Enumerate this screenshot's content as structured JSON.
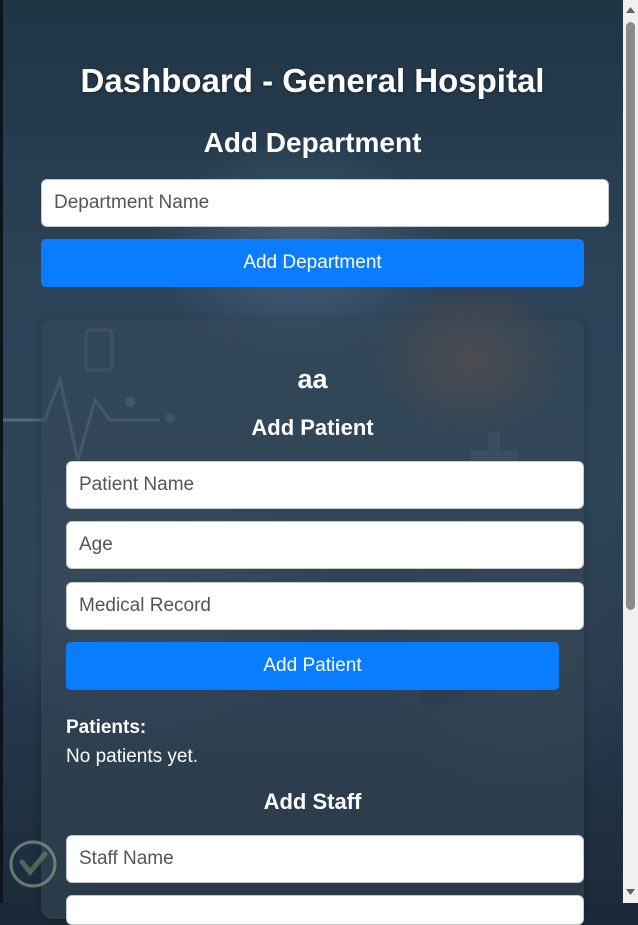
{
  "page_title": "Dashboard - General Hospital",
  "add_department": {
    "heading": "Add Department",
    "name_placeholder": "Department Name",
    "button_label": "Add Department"
  },
  "department": {
    "name": "aa",
    "add_patient": {
      "heading": "Add Patient",
      "name_placeholder": "Patient Name",
      "age_placeholder": "Age",
      "record_placeholder": "Medical Record",
      "button_label": "Add Patient"
    },
    "patients": {
      "label": "Patients:",
      "empty_text": "No patients yet."
    },
    "add_staff": {
      "heading": "Add Staff",
      "name_placeholder": "Staff Name"
    }
  },
  "colors": {
    "accent": "#0a7dff",
    "text": "#ffffff"
  },
  "icons": {
    "scroll_up": "triangle-up-icon",
    "scroll_down": "triangle-down-icon",
    "watermark": "shield-check-logo"
  }
}
